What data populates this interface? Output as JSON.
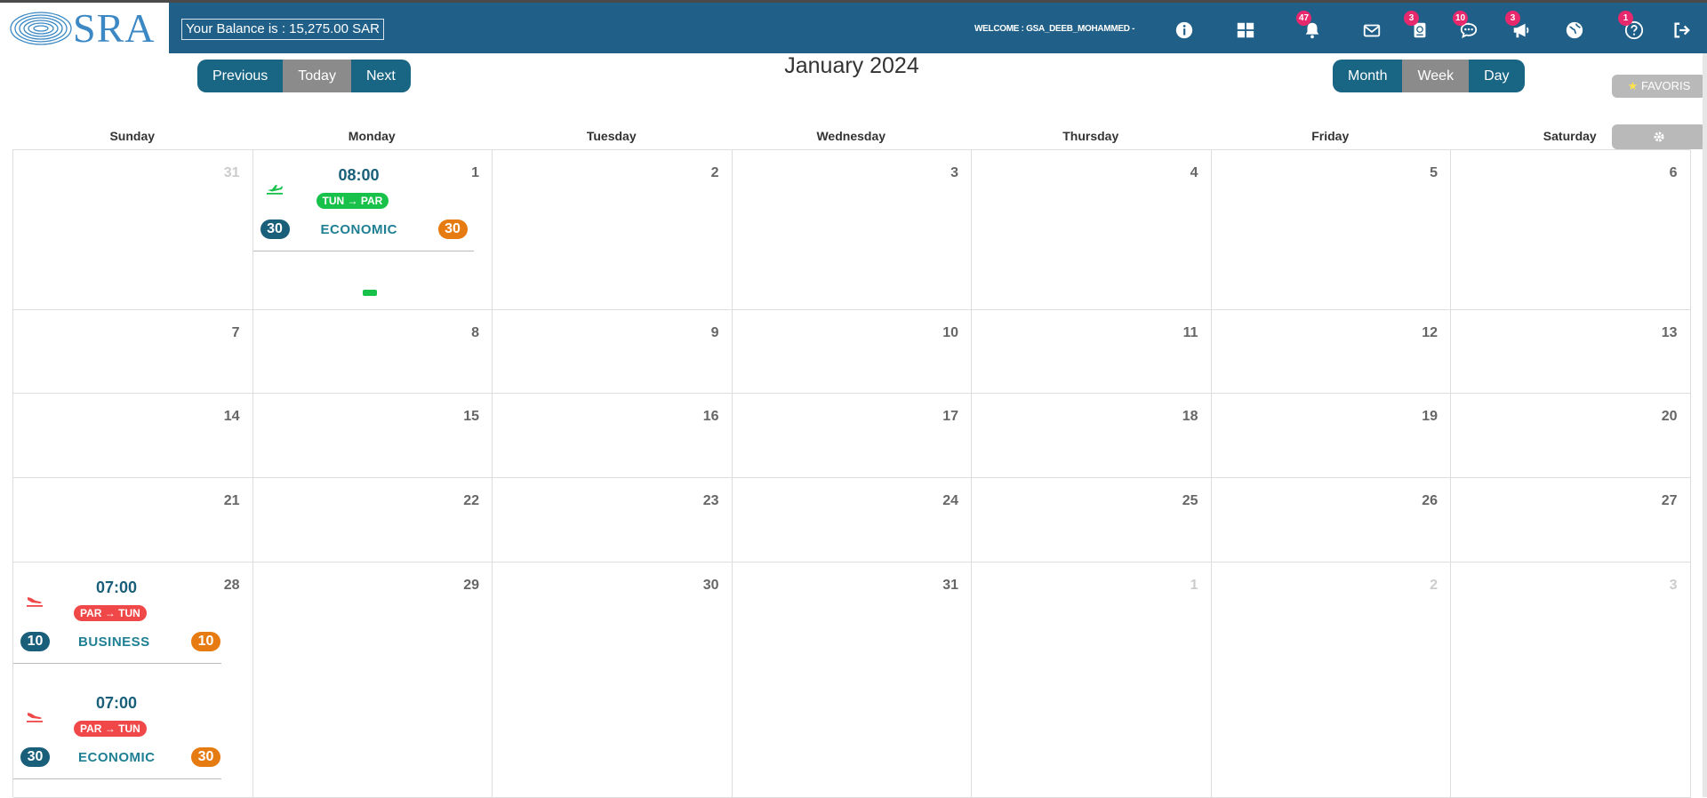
{
  "header": {
    "logo_text": "SRA",
    "balance": "Your Balance is : 15,275.00 SAR",
    "welcome": "WELCOME : GSA_DEEB_MOHAMMED -",
    "icons": [
      {
        "name": "info-icon",
        "badge": ""
      },
      {
        "name": "dashboard-icon",
        "badge": ""
      },
      {
        "name": "bell-icon",
        "badge": "47"
      },
      {
        "name": "mail-icon",
        "badge": ""
      },
      {
        "name": "passport-icon",
        "badge": "3"
      },
      {
        "name": "chat-icon",
        "badge": "10"
      },
      {
        "name": "megaphone-icon",
        "badge": "3"
      },
      {
        "name": "globe-icon",
        "badge": ""
      },
      {
        "name": "help-icon",
        "badge": "1"
      },
      {
        "name": "logout-icon",
        "badge": ""
      }
    ]
  },
  "nav": {
    "previous": "Previous",
    "today": "Today",
    "next": "Next",
    "title": "January 2024",
    "month": "Month",
    "week": "Week",
    "day": "Day",
    "favoris": "FAVORIS"
  },
  "weekdays": [
    "Sunday",
    "Monday",
    "Tuesday",
    "Wednesday",
    "Thursday",
    "Friday",
    "Saturday"
  ],
  "weeks": [
    [
      {
        "d": "31",
        "other": true
      },
      {
        "d": "1"
      },
      {
        "d": "2"
      },
      {
        "d": "3"
      },
      {
        "d": "4"
      },
      {
        "d": "5"
      },
      {
        "d": "6"
      }
    ],
    [
      {
        "d": "7"
      },
      {
        "d": "8"
      },
      {
        "d": "9"
      },
      {
        "d": "10"
      },
      {
        "d": "11"
      },
      {
        "d": "12"
      },
      {
        "d": "13"
      }
    ],
    [
      {
        "d": "14"
      },
      {
        "d": "15"
      },
      {
        "d": "16"
      },
      {
        "d": "17"
      },
      {
        "d": "18"
      },
      {
        "d": "19"
      },
      {
        "d": "20"
      }
    ],
    [
      {
        "d": "21"
      },
      {
        "d": "22"
      },
      {
        "d": "23"
      },
      {
        "d": "24"
      },
      {
        "d": "25"
      },
      {
        "d": "26"
      },
      {
        "d": "27"
      }
    ],
    [
      {
        "d": "28"
      },
      {
        "d": "29"
      },
      {
        "d": "30"
      },
      {
        "d": "31"
      },
      {
        "d": "1",
        "other": true
      },
      {
        "d": "2",
        "other": true
      },
      {
        "d": "3",
        "other": true
      }
    ]
  ],
  "events": {
    "jan1": {
      "time": "08:00",
      "route_from": "TUN",
      "route_to": "PAR",
      "left_count": "30",
      "class": "ECONOMIC",
      "right_count": "30"
    },
    "jan28_a": {
      "time": "07:00",
      "route_from": "PAR",
      "route_to": "TUN",
      "left_count": "10",
      "class": "BUSINESS",
      "right_count": "10"
    },
    "jan28_b": {
      "time": "07:00",
      "route_from": "PAR",
      "route_to": "TUN",
      "left_count": "30",
      "class": "ECONOMIC",
      "right_count": "30"
    }
  },
  "colors": {
    "header": "#1f5f88",
    "primary_button": "#196584",
    "muted_button": "#8b8b8b",
    "departure_green": "#18c24a",
    "arrival_red": "#f04848",
    "count_blue": "#1a5f7a",
    "count_orange": "#e67b12",
    "badge_pink": "#e8286c"
  }
}
